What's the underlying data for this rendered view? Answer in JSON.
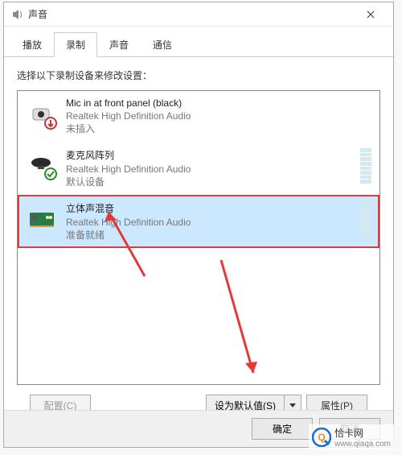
{
  "window": {
    "title": "声音"
  },
  "tabs": {
    "playback": "播放",
    "recording": "录制",
    "sounds": "声音",
    "communications": "通信",
    "active": "recording"
  },
  "instruction": "选择以下录制设备来修改设置：",
  "devices": [
    {
      "name": "Mic in at front panel (black)",
      "driver": "Realtek High Definition Audio",
      "status": "未插入",
      "icon": "jack-red-down"
    },
    {
      "name": "麦克风阵列",
      "driver": "Realtek High Definition Audio",
      "status": "默认设备",
      "icon": "mic-green-check"
    },
    {
      "name": "立体声混音",
      "driver": "Realtek High Definition Audio",
      "status": "准备就绪",
      "icon": "soundcard",
      "selected": true,
      "highlighted": true
    }
  ],
  "buttons": {
    "configure": "配置(C)",
    "set_default": "设为默认值(S)",
    "properties": "属性(P)",
    "ok": "确定",
    "cancel": "取消"
  },
  "watermark": {
    "name": "恰卡网",
    "url": "www.qiaqa.com"
  }
}
